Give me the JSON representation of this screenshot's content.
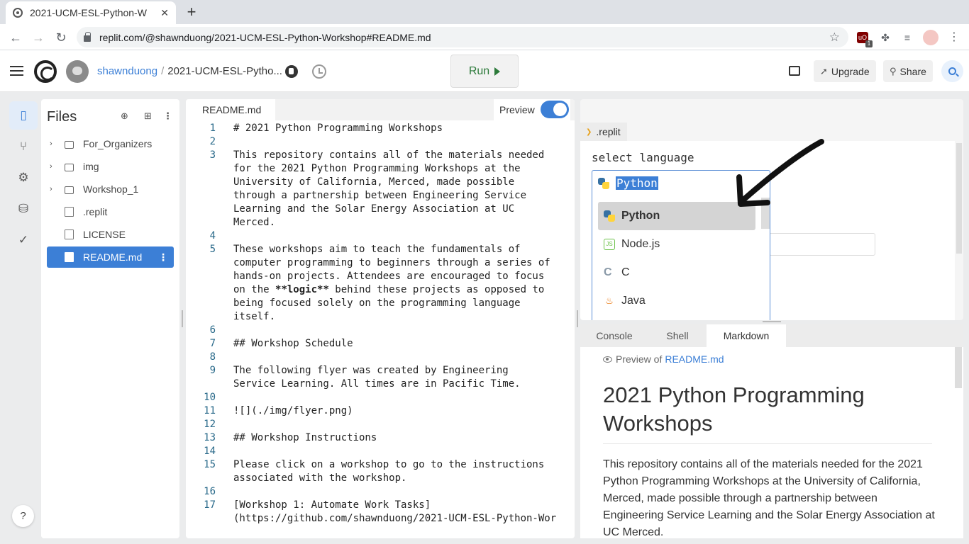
{
  "browser": {
    "tab_title": "2021-UCM-ESL-Python-W",
    "tab_close": "✕",
    "new_tab": "+",
    "url": "replit.com/@shawnduong/2021-UCM-ESL-Python-Workshop#README.md",
    "back_icon": "arrow-left-icon",
    "forward_icon": "arrow-right-icon",
    "reload_icon": "reload-icon",
    "ext_ublock_badge": "1"
  },
  "header": {
    "username": "shawnduong",
    "separator": "/",
    "repl_name": "2021-UCM-ESL-Pytho...",
    "run_label": "Run",
    "upgrade_label": "Upgrade",
    "share_label": "Share"
  },
  "files": {
    "title": "Files",
    "items": [
      {
        "label": "For_Organizers",
        "type": "folder"
      },
      {
        "label": "img",
        "type": "folder"
      },
      {
        "label": "Workshop_1",
        "type": "folder"
      },
      {
        "label": ".replit",
        "type": "file"
      },
      {
        "label": "LICENSE",
        "type": "file"
      },
      {
        "label": "README.md",
        "type": "file",
        "selected": true
      }
    ],
    "help": "?"
  },
  "editor": {
    "tab": "README.md",
    "preview_label": "Preview",
    "preview_on": true,
    "lines": [
      {
        "n": "1",
        "t": "# 2021 Python Programming Workshops",
        "c": "h"
      },
      {
        "n": "2",
        "t": ""
      },
      {
        "n": "3",
        "t": "This repository contains all of the materials needed\nfor the 2021 Python Programming Workshops at the\nUniversity of California, Merced, made possible\nthrough a partnership between Engineering Service\nLearning and the Solar Energy Association at UC\nMerced."
      },
      {
        "n": "4",
        "t": ""
      },
      {
        "n": "5",
        "t": "These workshops aim to teach the fundamentals of\ncomputer programming to beginners through a series of\nhands-on projects. Attendees are encouraged to focus\non the **logic** behind these projects as opposed to\nbeing focused solely on the programming language\nitself."
      },
      {
        "n": "6",
        "t": ""
      },
      {
        "n": "7",
        "t": "## Workshop Schedule",
        "c": "h"
      },
      {
        "n": "8",
        "t": ""
      },
      {
        "n": "9",
        "t": "The following flyer was created by Engineering\nService Learning. All times are in Pacific Time."
      },
      {
        "n": "10",
        "t": ""
      },
      {
        "n": "11",
        "t": "![](./img/flyer.png)",
        "c": "lk"
      },
      {
        "n": "12",
        "t": ""
      },
      {
        "n": "13",
        "t": "## Workshop Instructions",
        "c": "h"
      },
      {
        "n": "14",
        "t": ""
      },
      {
        "n": "15",
        "t": "Please click on a workshop to go to the instructions\nassociated with the workshop."
      },
      {
        "n": "16",
        "t": ""
      },
      {
        "n": "17",
        "t": "[Workshop 1: Automate Work Tasks]\n(https://github.com/shawnduong/2021-UCM-ESL-Python-Wor",
        "c": "lk"
      }
    ]
  },
  "config": {
    "tab": ".replit",
    "label": "select language",
    "selected": "Python",
    "options": [
      "Python",
      "Node.js",
      "C",
      "Java"
    ],
    "highlighted": "Python"
  },
  "bottom_tabs": {
    "items": [
      "Console",
      "Shell",
      "Markdown"
    ],
    "active": "Markdown"
  },
  "markdown": {
    "preview_of": "Preview of",
    "file": "README.md",
    "h1": "2021 Python Programming Workshops",
    "p": "This repository contains all of the materials needed for the 2021 Python Programming Workshops at the University of California, Merced, made possible through a partnership between Engineering Service Learning and the Solar Energy Association at UC Merced."
  },
  "colors": {
    "accent": "#3c7fd6",
    "run_green": "#2c7a3a",
    "md_heading": "#1a1ac8",
    "md_link": "#b22222"
  }
}
